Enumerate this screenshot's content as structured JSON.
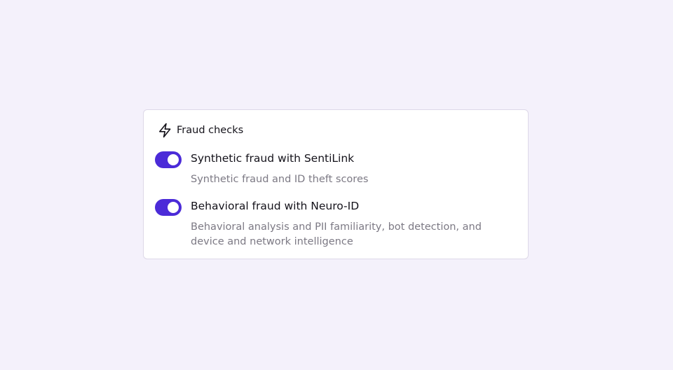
{
  "panel": {
    "title": "Fraud checks",
    "icon": "lightning-bolt-icon"
  },
  "options": [
    {
      "title": "Synthetic fraud with SentiLink",
      "description": "Synthetic fraud and ID theft scores",
      "enabled": true
    },
    {
      "title": "Behavioral fraud with Neuro-ID",
      "description": "Behavioral analysis and PII familiarity, bot detection, and device and network intelligence",
      "enabled": true
    }
  ],
  "colors": {
    "background": "#f4f1fb",
    "toggle_on": "#4b2bd8",
    "title_text": "#14121a",
    "description_text": "#7c7984"
  }
}
